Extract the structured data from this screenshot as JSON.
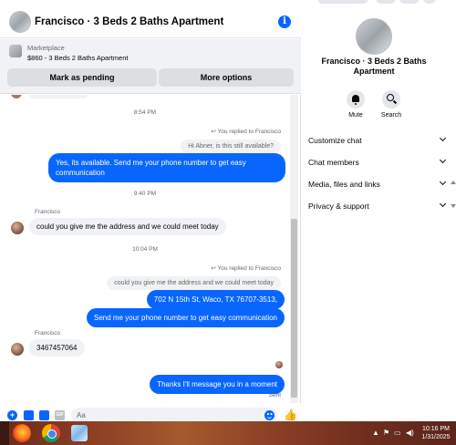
{
  "header": {
    "title": "Francisco · 3 Beds 2 Baths Apartment",
    "info_icon": "info-icon"
  },
  "marketplace": {
    "label": "Marketplace",
    "listing": "$860 - 3 Beds 2 Baths Apartment",
    "mark_pending": "Mark as pending",
    "more_options": "More options"
  },
  "messages": {
    "ts1": "8:54 PM",
    "replied1": "You replied to Francisco",
    "quote1": "Hi Abner, is this still available?",
    "out1": "Yes, its available. Send me your phone number to get easy communication",
    "ts2": "9:40 PM",
    "sender1": "Francisco",
    "in1": "could you give me the address and we could meet today",
    "ts3": "10:04 PM",
    "replied2": "You replied to Francisco",
    "quote2": "could you give me the address and we could meet today",
    "out2": "702 N 15th St, Waco, TX 76707-3513,",
    "out3": "Send me your phone number to get easy communication",
    "sender2": "Francisco",
    "in2": "3467457064",
    "out4": "Thanks I'll message you in a moment",
    "sent": "Sent"
  },
  "composer": {
    "placeholder": "Aa",
    "gif_label": "GIF"
  },
  "sidebar": {
    "title": "Francisco · 3 Beds 2 Baths Apartment",
    "mute": "Mute",
    "search": "Search",
    "sections": [
      "Customize chat",
      "Chat members",
      "Media, files and links",
      "Privacy & support"
    ]
  },
  "taskbar": {
    "time": "10:16 PM",
    "date": "1/31/2025"
  }
}
